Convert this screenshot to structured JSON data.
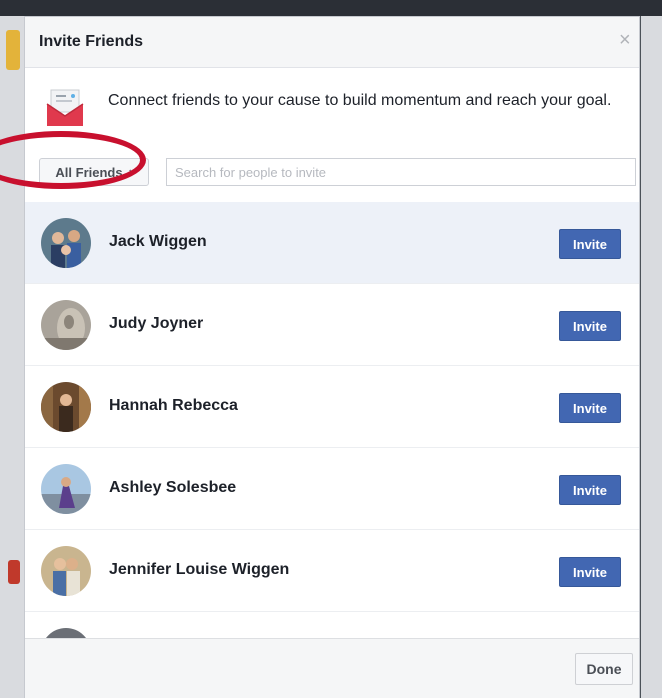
{
  "dialog": {
    "title": "Invite Friends",
    "close_icon": "close-icon",
    "intro_text": "Connect friends to your cause to build momentum and reach your goal."
  },
  "filter": {
    "label": "All Friends",
    "arrow": "↕",
    "search_placeholder": "Search for people to invite"
  },
  "friends": [
    {
      "name": "Jack Wiggen",
      "button": "Invite",
      "highlighted": true
    },
    {
      "name": "Judy Joyner",
      "button": "Invite",
      "highlighted": false
    },
    {
      "name": "Hannah Rebecca",
      "button": "Invite",
      "highlighted": false
    },
    {
      "name": "Ashley Solesbee",
      "button": "Invite",
      "highlighted": false
    },
    {
      "name": "Jennifer Louise Wiggen",
      "button": "Invite",
      "highlighted": false
    }
  ],
  "footer": {
    "done_label": "Done"
  },
  "colors": {
    "primary": "#4267b2",
    "annotation": "#c8102e",
    "highlight_row": "#edf1f8"
  }
}
